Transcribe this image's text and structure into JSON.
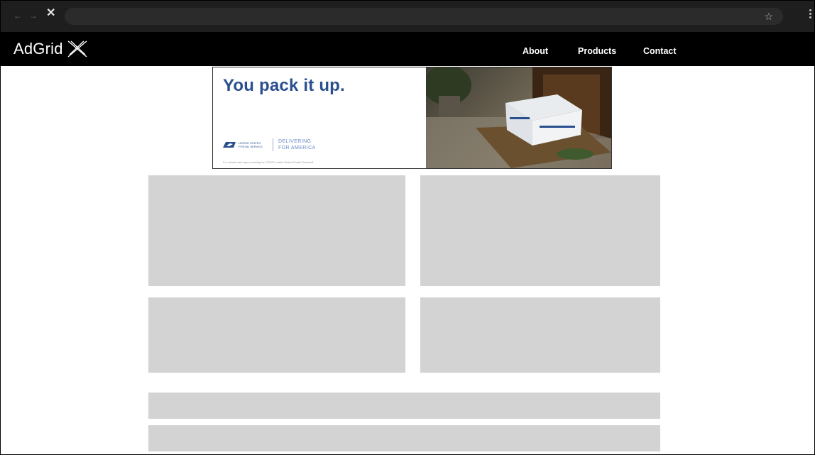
{
  "browser": {
    "back_icon": "←",
    "forward_icon": "→",
    "stop_icon": "✕",
    "bookmark_icon": "☆",
    "address_value": ""
  },
  "site": {
    "brand_name": "AdGrid",
    "nav": [
      "About",
      "Products",
      "Contact"
    ]
  },
  "ad": {
    "headline": "You pack it up.",
    "org_name": "UNITED STATES POSTAL SERVICE",
    "tagline_line1": "DELIVERING",
    "tagline_line2": "FOR AMERICA",
    "legal": "For details visit usps.com/ship/us. ©2022 United States Postal Service®.",
    "brand_color": "#2a4f8f"
  },
  "colors": {
    "header_bg": "#000000",
    "chrome_bg": "#1e1e1e",
    "placeholder": "#d3d3d3"
  }
}
